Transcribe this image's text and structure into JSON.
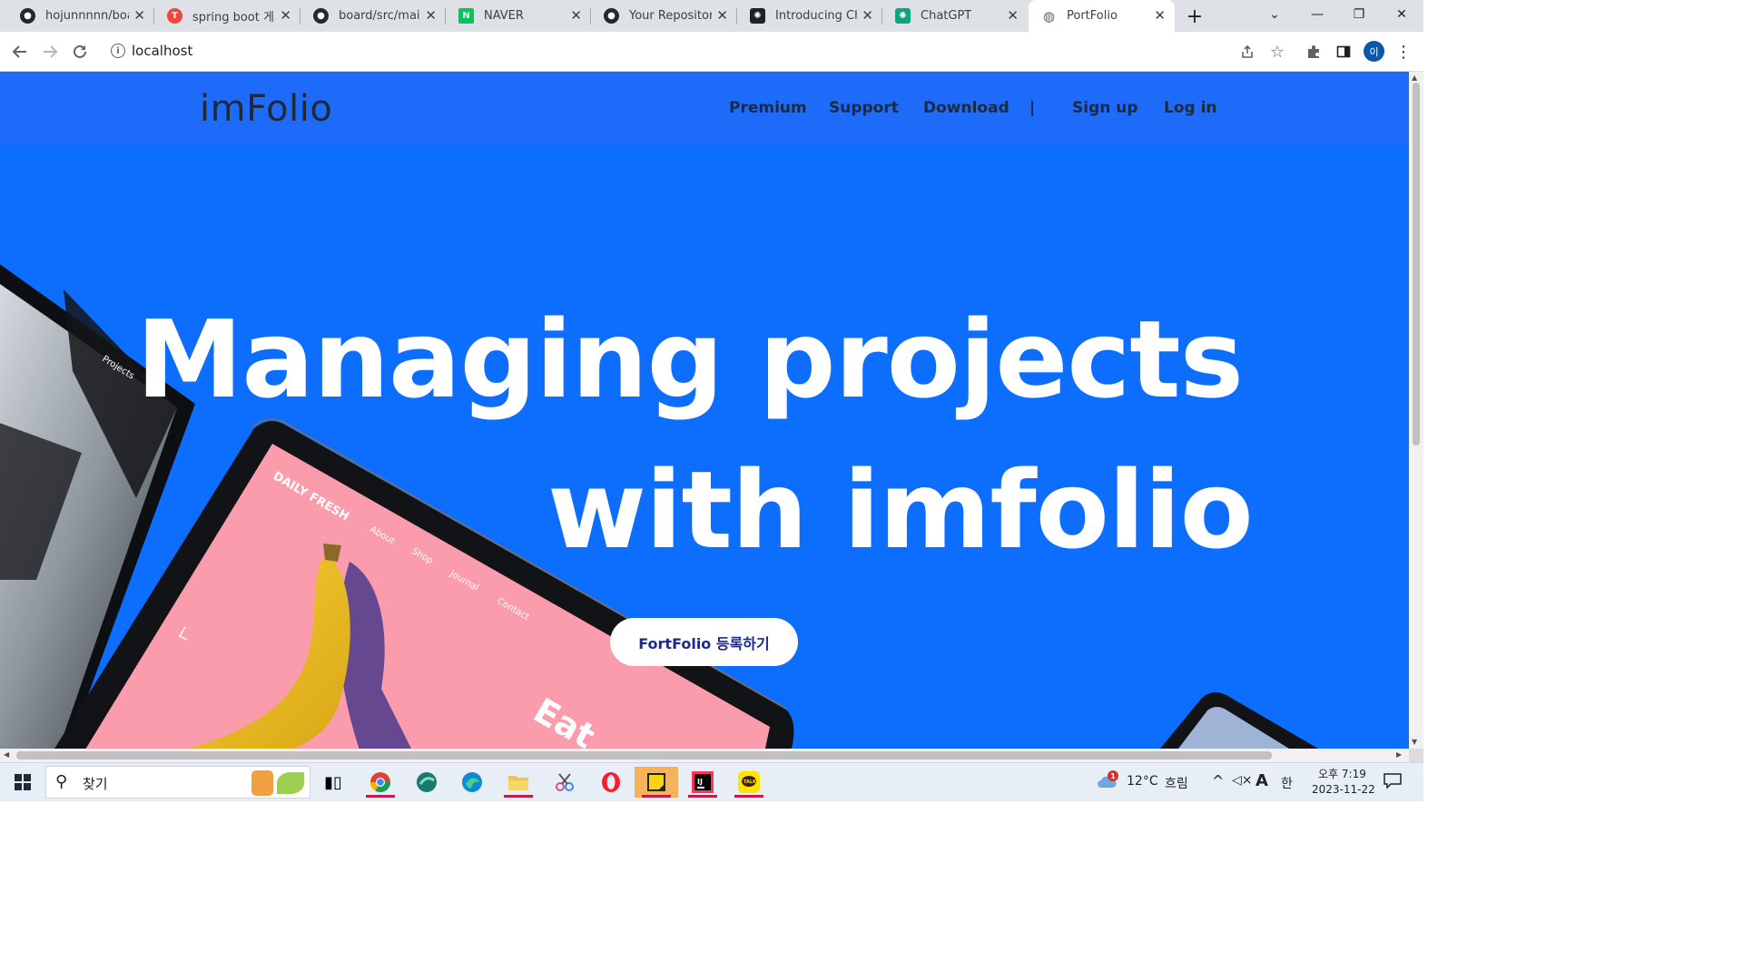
{
  "browser": {
    "tabs": [
      {
        "title": "hojunnnnn/boar",
        "icon": "github-icon",
        "color": "#24292f"
      },
      {
        "title": "spring boot 게시",
        "icon": "red-t-icon",
        "color": "#f0443f"
      },
      {
        "title": "board/src/main/",
        "icon": "github-icon",
        "color": "#24292f"
      },
      {
        "title": "NAVER",
        "icon": "naver-icon",
        "color": "#03c75a"
      },
      {
        "title": "Your Repositorie",
        "icon": "github-icon",
        "color": "#24292f"
      },
      {
        "title": "Introducing Cha",
        "icon": "openai-icon",
        "color": "#202123"
      },
      {
        "title": "ChatGPT",
        "icon": "chatgpt-icon",
        "color": "#10a37f"
      },
      {
        "title": "PortFolio",
        "icon": "globe-icon",
        "color": "#5f6368",
        "active": true
      }
    ],
    "url": "localhost",
    "profile_initial": "이"
  },
  "site": {
    "logo": "imFolio",
    "nav": {
      "premium": "Premium",
      "support": "Support",
      "download": "Download",
      "divider": "|",
      "signup": "Sign up",
      "login": "Log in"
    },
    "hero": {
      "line1": "Managing projects",
      "line2": "with imfolio"
    },
    "cta": "FortFolio 등록하기",
    "mockup": {
      "brand": "DAILY FRESH",
      "menu": [
        "About",
        "Shop",
        "Journal",
        "Contact"
      ],
      "headline": "Eat",
      "left_label": "Projects"
    },
    "colors": {
      "bg": "#0d6efd",
      "nav_bg": "#1f6bf9",
      "pink": "#fb9cad"
    }
  },
  "taskbar": {
    "search": "찾기",
    "weather": {
      "temp": "12°C",
      "desc": "흐림",
      "alert_count": "1"
    },
    "ime": "한",
    "font_indicator": "A",
    "clock": {
      "time": "오후 7:19",
      "date": "2023-11-22"
    }
  }
}
